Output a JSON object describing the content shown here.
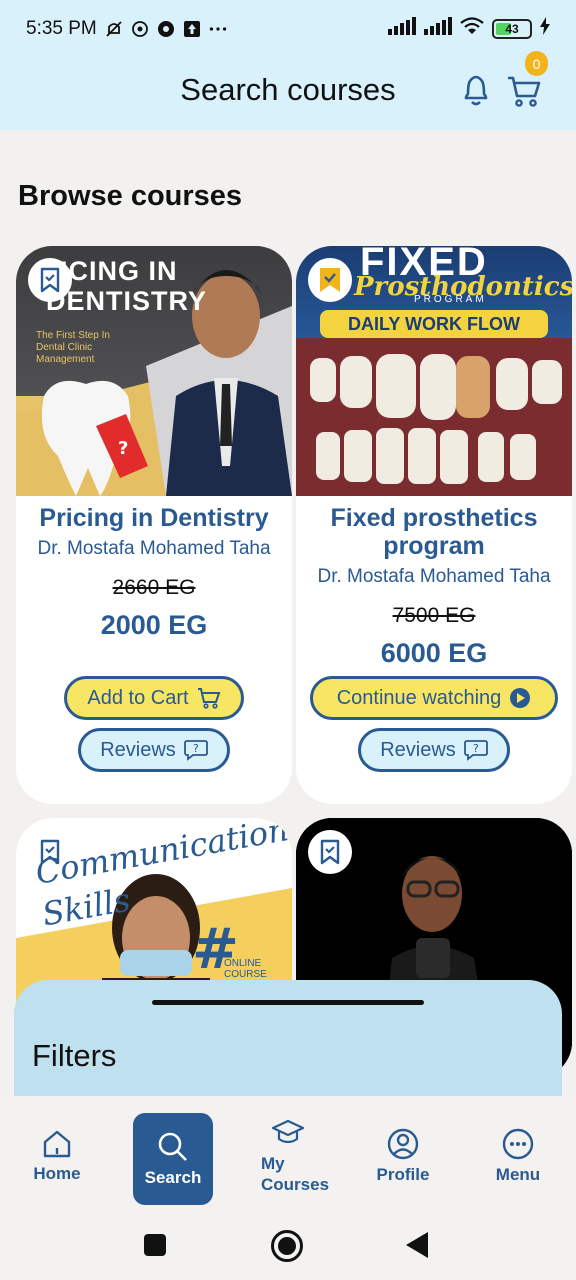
{
  "status_bar": {
    "time": "5:35 PM",
    "battery": "43"
  },
  "header": {
    "title": "Search courses",
    "cart_count": "0"
  },
  "section_title": "Browse courses",
  "courses": [
    {
      "title": "Pricing in Dentistry",
      "author": "Dr. Mostafa Mohamed Taha",
      "old_price": "2660 EG",
      "price": "2000 EG",
      "primary_action": "Add to Cart",
      "reviews_label": "Reviews",
      "thumb_text_1": "ICING IN",
      "thumb_text_2": "DENTISTRY",
      "thumb_sub": "The First Step In Dental Clinic Management"
    },
    {
      "title": "Fixed prosthetics program",
      "author": "Dr. Mostafa Mohamed Taha",
      "old_price": "7500 EG",
      "price": "6000 EG",
      "primary_action": "Continue watching",
      "reviews_label": "Reviews",
      "thumb_text_1": "FIXED",
      "thumb_text_2": "Prosthodontics",
      "thumb_sub": "PROGRAM",
      "thumb_banner": "DAILY WORK FLOW"
    },
    {
      "thumb_text_1": "Communication",
      "thumb_text_2": "Skills",
      "thumb_sub": "ONLINE COURSE"
    },
    {}
  ],
  "filters": {
    "title": "Filters"
  },
  "bottom_nav": {
    "items": [
      {
        "label": "Home",
        "icon": "home-icon"
      },
      {
        "label": "Search",
        "icon": "search-icon"
      },
      {
        "label": "My Courses",
        "icon": "graduation-cap-icon"
      },
      {
        "label": "Profile",
        "icon": "profile-icon"
      },
      {
        "label": "Menu",
        "icon": "menu-dots-icon"
      }
    ],
    "active": "Search"
  },
  "colors": {
    "primary": "#2a5a92",
    "accent_yellow": "#f7e564",
    "header_bg": "#d8f1fb",
    "badge": "#f2b31b"
  }
}
